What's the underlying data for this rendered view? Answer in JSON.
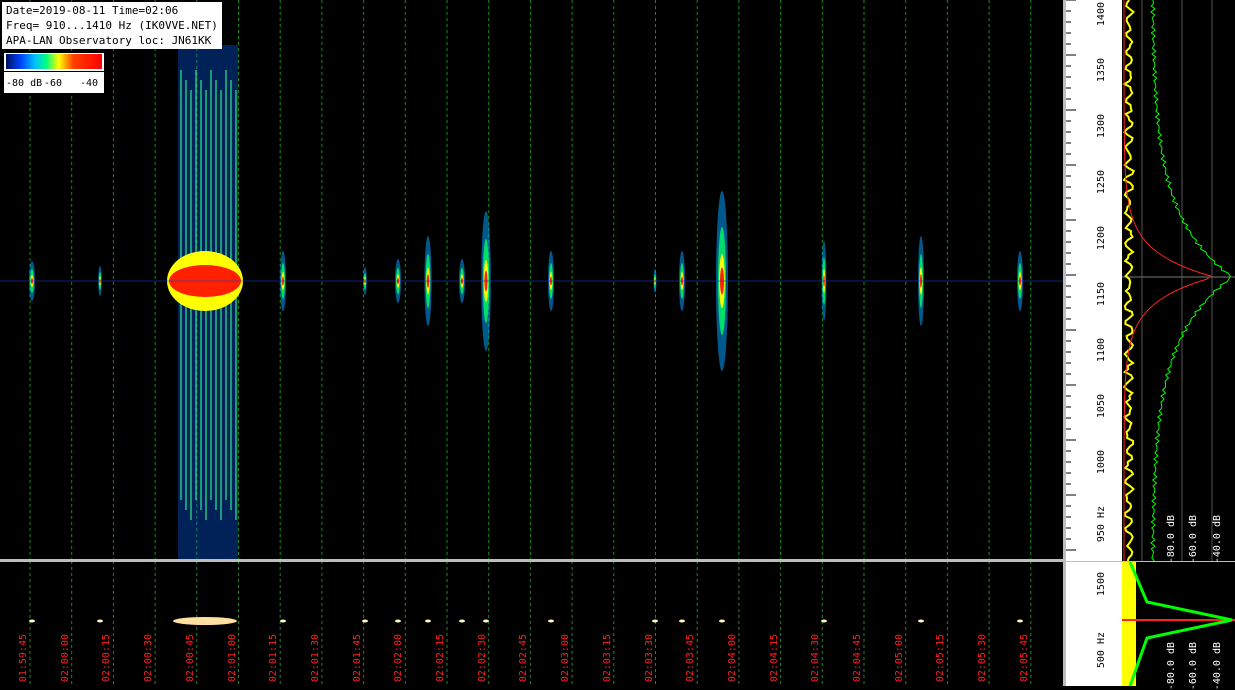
{
  "info": {
    "line1": "Date=2019-08-11 Time=02:06",
    "line2": "Freq= 910...1410 Hz (IK0VVE.NET)",
    "line3": "APA-LAN Observatory loc: JN61KK"
  },
  "colorbar": {
    "labels": [
      "-80 dB",
      "-60",
      "-40"
    ]
  },
  "time_labels": [
    "01:59:45",
    "02:00:00",
    "02:00:15",
    "02:00:30",
    "02:00:45",
    "02:01:00",
    "02:01:15",
    "02:01:30",
    "02:01:45",
    "02:02:00",
    "02:02:15",
    "02:02:30",
    "02:02:45",
    "02:03:00",
    "02:03:15",
    "02:03:30",
    "02:03:45",
    "02:04:00",
    "02:04:15",
    "02:04:30",
    "02:04:45",
    "02:05:00",
    "02:05:15",
    "02:05:30",
    "02:05:45"
  ],
  "freq_labels": [
    "1400",
    "1350",
    "1300",
    "1250",
    "1200",
    "1150",
    "1100",
    "1050",
    "1000",
    "950 Hz"
  ],
  "db_labels": [
    "-80.0 dB",
    "-60.0 dB",
    "-40.0 dB"
  ],
  "lower_freq_labels": [
    "1500",
    "500 Hz"
  ],
  "lower_db_labels": [
    "-80.0 dB",
    "-60.0 dB",
    "-40.0 dB"
  ],
  "colors": {
    "grid": "#1e8a1e",
    "time_text": "#ff2020",
    "spectrum_avg": "#ffff00",
    "spectrum_peak": "#00ff00",
    "spectrum_red": "#ff2020"
  }
}
